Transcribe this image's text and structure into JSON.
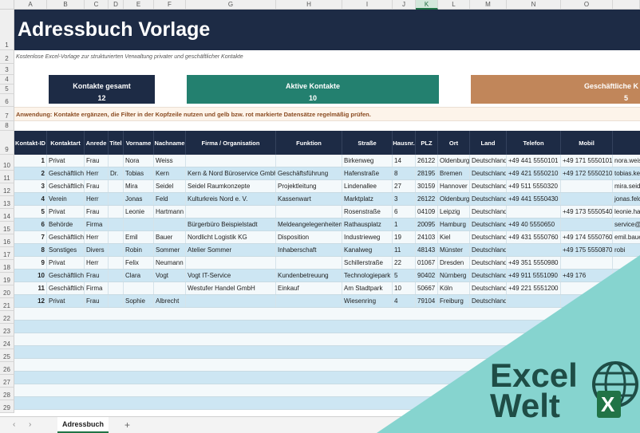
{
  "columns": [
    "A",
    "B",
    "C",
    "D",
    "E",
    "F",
    "G",
    "H",
    "I",
    "J",
    "K",
    "L",
    "M",
    "N",
    "O"
  ],
  "selected_column": "K",
  "rows": [
    "1",
    "2",
    "3",
    "4",
    "5",
    "6",
    "7",
    "8",
    "9",
    "10",
    "11",
    "12",
    "13",
    "14",
    "15",
    "16",
    "17",
    "18",
    "19",
    "20",
    "21",
    "22",
    "23",
    "24",
    "25",
    "26",
    "27",
    "28",
    "29"
  ],
  "title": "Adressbuch Vorlage",
  "subtitle": "Kostenlose Excel-Vorlage zur strukturierten Verwaltung privater und geschäftlicher Kontakte",
  "kpis": [
    {
      "label": "Kontakte gesamt",
      "value": "12",
      "color": "#1d2b45"
    },
    {
      "label": "Aktive Kontakte",
      "value": "10",
      "color": "#23806f"
    },
    {
      "label": "Geschäftliche K",
      "value": "5",
      "color": "#c1865a"
    }
  ],
  "usage": "Anwendung: Kontakte ergänzen, die Filter in der Kopfzeile nutzen und gelb bzw. rot markierte Datensätze regelmäßig prüfen.",
  "table": {
    "headers": [
      "Kontakt-ID",
      "Kontaktart",
      "Anrede",
      "Titel",
      "Vorname",
      "Nachname",
      "Firma / Organisation",
      "Funktion",
      "Straße",
      "Hausnr.",
      "PLZ",
      "Ort",
      "Land",
      "Telefon",
      "Mobil",
      ""
    ],
    "rows": [
      [
        "1",
        "Privat",
        "Frau",
        "",
        "Nora",
        "Weiss",
        "",
        "",
        "Birkenweg",
        "14",
        "26122",
        "Oldenburg",
        "Deutschland",
        "+49 441 5550101",
        "+49 171 5550101",
        "nora.weis"
      ],
      [
        "2",
        "Geschäftlich",
        "Herr",
        "Dr.",
        "Tobias",
        "Kern",
        "Kern & Nord Büroservice GmbH",
        "Geschäftsführung",
        "Hafenstraße",
        "8",
        "28195",
        "Bremen",
        "Deutschland",
        "+49 421 5550210",
        "+49 172 5550210",
        "tobias.ker"
      ],
      [
        "3",
        "Geschäftlich",
        "Frau",
        "",
        "Mira",
        "Seidel",
        "Seidel Raumkonzepte",
        "Projektleitung",
        "Lindenallee",
        "27",
        "30159",
        "Hannover",
        "Deutschland",
        "+49 511 5550320",
        "",
        "mira.seid"
      ],
      [
        "4",
        "Verein",
        "Herr",
        "",
        "Jonas",
        "Feld",
        "Kulturkreis Nord e. V.",
        "Kassenwart",
        "Marktplatz",
        "3",
        "26122",
        "Oldenburg",
        "Deutschland",
        "+49 441 5550430",
        "",
        "jonas.felc"
      ],
      [
        "5",
        "Privat",
        "Frau",
        "",
        "Leonie",
        "Hartmann",
        "",
        "",
        "Rosenstraße",
        "6",
        "04109",
        "Leipzig",
        "Deutschland",
        "",
        "+49 173 5550540",
        "leonie.ha"
      ],
      [
        "6",
        "Behörde",
        "Firma",
        "",
        "",
        "",
        "Bürgerbüro Beispielstadt",
        "Meldeangelegenheiten",
        "Rathausplatz",
        "1",
        "20095",
        "Hamburg",
        "Deutschland",
        "+49 40 5550650",
        "",
        "service@"
      ],
      [
        "7",
        "Geschäftlich",
        "Herr",
        "",
        "Emil",
        "Bauer",
        "Nordlicht Logistik KG",
        "Disposition",
        "Industrieweg",
        "19",
        "24103",
        "Kiel",
        "Deutschland",
        "+49 431 5550760",
        "+49 174 5550760",
        "emil.baue"
      ],
      [
        "8",
        "Sonstiges",
        "Divers",
        "",
        "Robin",
        "Sommer",
        "Atelier Sommer",
        "Inhaberschaft",
        "Kanalweg",
        "11",
        "48143",
        "Münster",
        "Deutschland",
        "",
        "+49 175 5550870",
        "robi"
      ],
      [
        "9",
        "Privat",
        "Herr",
        "",
        "Felix",
        "Neumann",
        "",
        "",
        "Schillerstraße",
        "22",
        "01067",
        "Dresden",
        "Deutschland",
        "+49 351 5550980",
        "",
        ""
      ],
      [
        "10",
        "Geschäftlich",
        "Frau",
        "",
        "Clara",
        "Vogt",
        "Vogt IT-Service",
        "Kundenbetreuung",
        "Technologiepark",
        "5",
        "90402",
        "Nürnberg",
        "Deutschland",
        "+49 911 5551090",
        "+49 176",
        ""
      ],
      [
        "11",
        "Geschäftlich",
        "Firma",
        "",
        "",
        "",
        "Westufer Handel GmbH",
        "Einkauf",
        "Am Stadtpark",
        "10",
        "50667",
        "Köln",
        "Deutschland",
        "+49 221 5551200",
        "",
        ""
      ],
      [
        "12",
        "Privat",
        "Frau",
        "",
        "Sophie",
        "Albrecht",
        "",
        "",
        "Wiesenring",
        "4",
        "79104",
        "Freiburg",
        "Deutschland",
        "",
        "",
        ""
      ]
    ]
  },
  "sheet_tab": "Adressbuch",
  "logo": {
    "line1": "Excel",
    "line2": "Welt",
    "badge": "X"
  },
  "colors": {
    "navy": "#1d2b45",
    "teal_overlay": "#86d4cf",
    "logo_green": "#1f4d46",
    "excel_green": "#217346"
  }
}
